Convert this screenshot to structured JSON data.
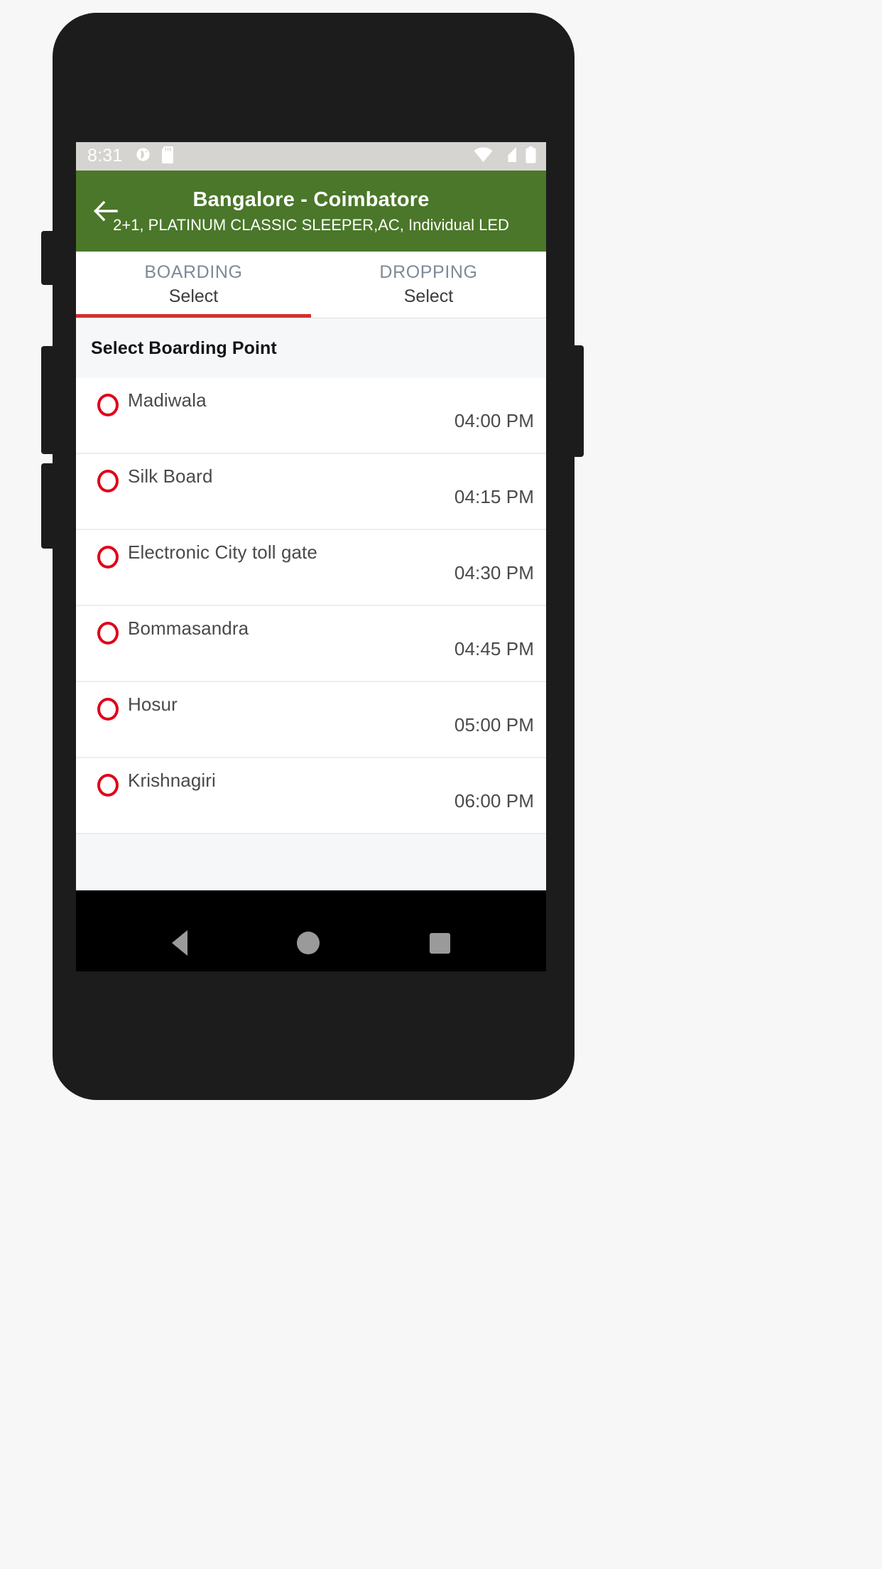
{
  "status_bar": {
    "time": "8:31",
    "left_icons": [
      "do-not-disturb-icon",
      "sd-card-icon"
    ],
    "right_icons": [
      "wifi-icon",
      "cell-signal-icon",
      "battery-icon"
    ]
  },
  "app_bar": {
    "back_icon": "arrow-left-icon",
    "title": "Bangalore - Coimbatore",
    "subtitle": "2+1, PLATINUM CLASSIC SLEEPER,AC, Individual LED",
    "background_color": "#4a7729"
  },
  "tabs": [
    {
      "label": "BOARDING",
      "value": "Select",
      "active": true
    },
    {
      "label": "DROPPING",
      "value": "Select",
      "active": false
    }
  ],
  "tab_indicator_color": "#d32f2f",
  "section": {
    "title": "Select Boarding Point"
  },
  "boarding_points": [
    {
      "name": "Madiwala",
      "time": "04:00 PM",
      "selected": false
    },
    {
      "name": "Silk Board",
      "time": "04:15 PM",
      "selected": false
    },
    {
      "name": "Electronic City toll gate",
      "time": "04:30 PM",
      "selected": false
    },
    {
      "name": "Bommasandra",
      "time": "04:45 PM",
      "selected": false
    },
    {
      "name": "Hosur",
      "time": "05:00 PM",
      "selected": false
    },
    {
      "name": "Krishnagiri",
      "time": "06:00 PM",
      "selected": false
    }
  ],
  "radio_color": "#e00019",
  "nav_bar": {
    "back": "triangle-back-icon",
    "home": "circle-home-icon",
    "recents": "square-recents-icon"
  }
}
